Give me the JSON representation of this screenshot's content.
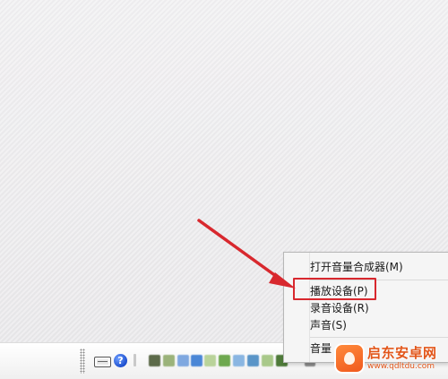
{
  "context_menu": {
    "items": [
      {
        "label": "打开音量合成器(M)"
      },
      {
        "label": "播放设备(P)"
      },
      {
        "label": "录音设备(R)"
      },
      {
        "label": "声音(S)"
      },
      {
        "label": "音量"
      }
    ]
  },
  "taskbar": {
    "help_glyph": "?"
  },
  "annotation": {
    "arrow_color": "#d8282e",
    "highlight_color": "#d8282e"
  },
  "watermark": {
    "title": "启东安卓网",
    "url": "www.qdltdu.com"
  }
}
